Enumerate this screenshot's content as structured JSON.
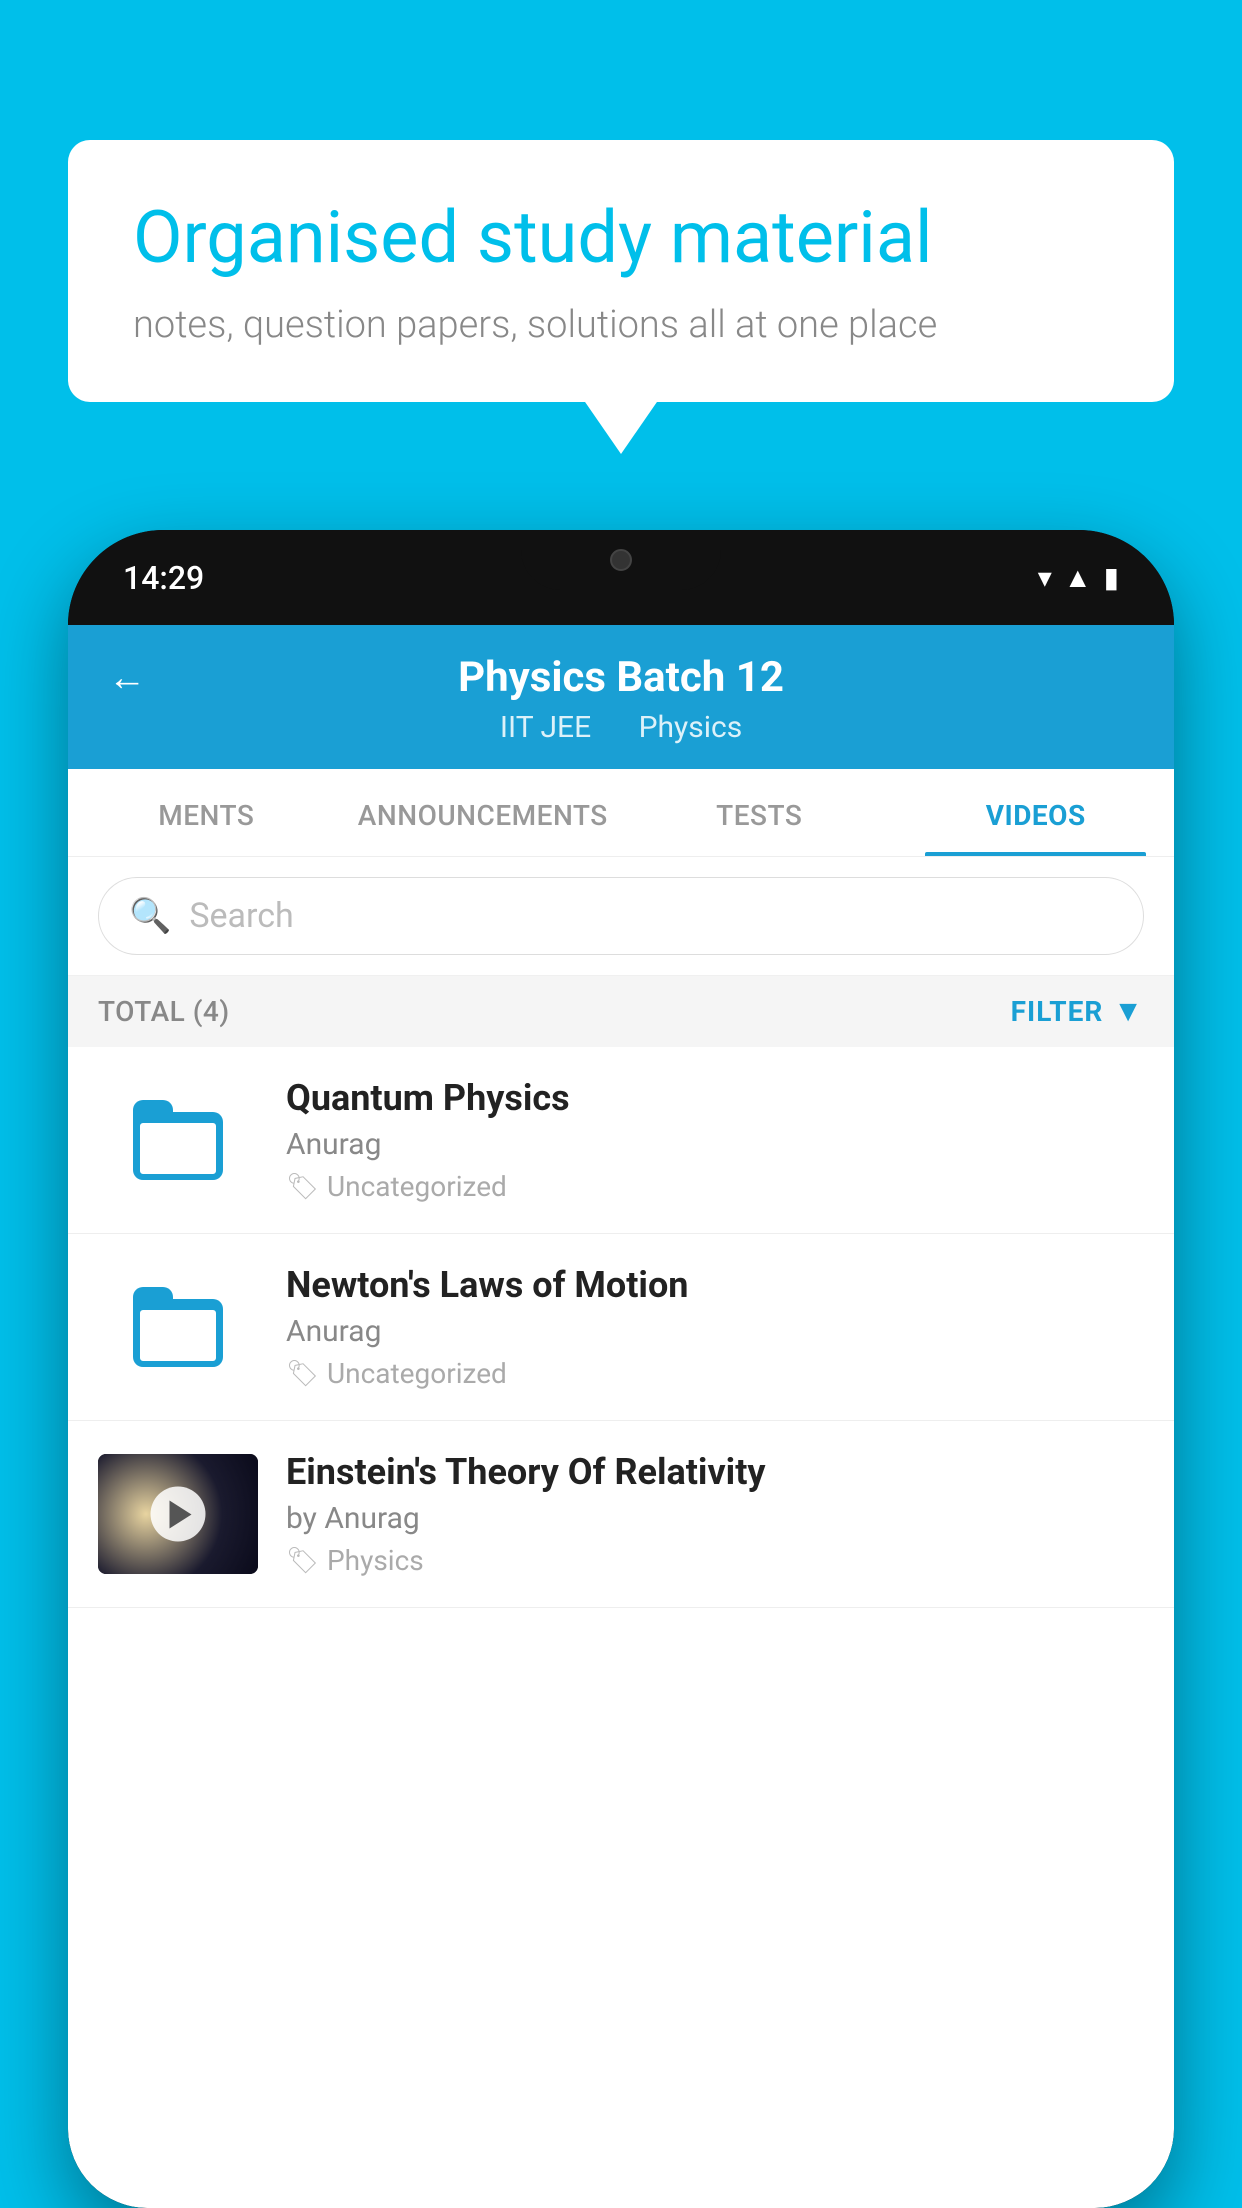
{
  "background_color": "#00BFEA",
  "speech_bubble": {
    "title": "Organised study material",
    "subtitle": "notes, question papers, solutions all at one place"
  },
  "phone": {
    "status_bar": {
      "time": "14:29"
    },
    "header": {
      "back_label": "←",
      "title": "Physics Batch 12",
      "subtitle_part1": "IIT JEE",
      "subtitle_part2": "Physics"
    },
    "tabs": [
      {
        "label": "MENTS",
        "active": false
      },
      {
        "label": "ANNOUNCEMENTS",
        "active": false
      },
      {
        "label": "TESTS",
        "active": false
      },
      {
        "label": "VIDEOS",
        "active": true
      }
    ],
    "search": {
      "placeholder": "Search"
    },
    "filter_row": {
      "total_label": "TOTAL (4)",
      "filter_label": "FILTER"
    },
    "videos": [
      {
        "id": 1,
        "title": "Quantum Physics",
        "author": "Anurag",
        "tag": "Uncategorized",
        "has_thumbnail": false
      },
      {
        "id": 2,
        "title": "Newton's Laws of Motion",
        "author": "Anurag",
        "tag": "Uncategorized",
        "has_thumbnail": false
      },
      {
        "id": 3,
        "title": "Einstein's Theory Of Relativity",
        "author": "by Anurag",
        "tag": "Physics",
        "has_thumbnail": true
      }
    ]
  }
}
